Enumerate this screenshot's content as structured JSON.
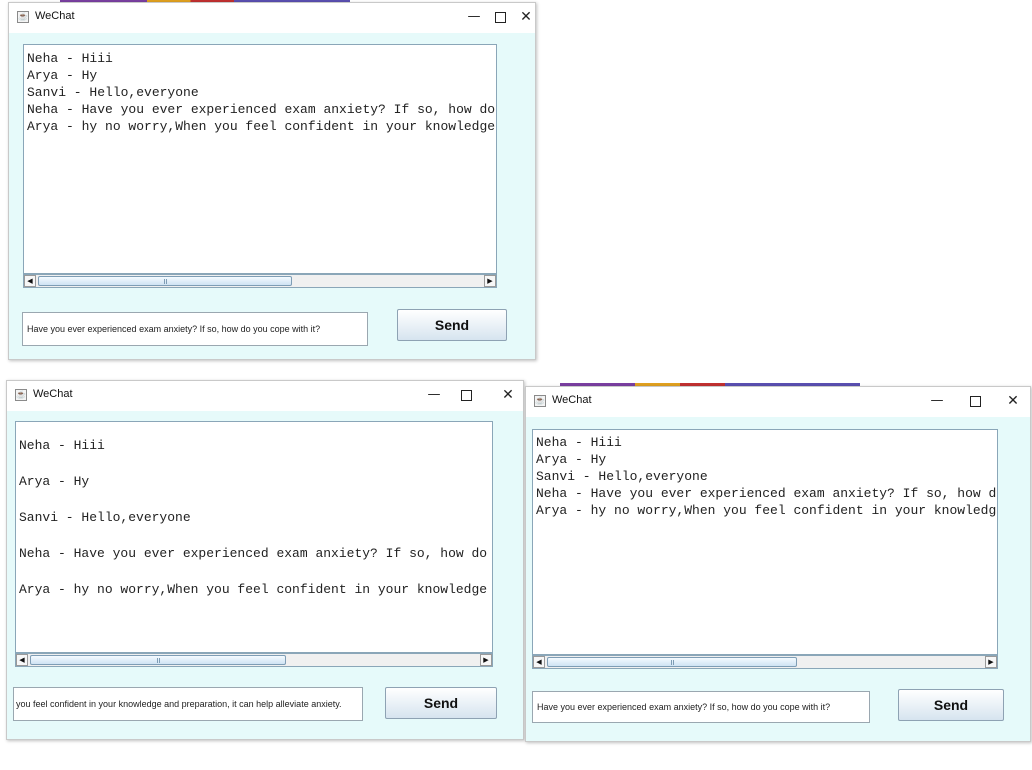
{
  "windows": [
    {
      "title": "WeChat",
      "controls": {
        "minimize": "—",
        "close": "✕"
      },
      "messages": [
        "Neha - Hiii",
        "Arya - Hy",
        "Sanvi - Hello,everyone",
        "Neha - Have you ever experienced exam anxiety? If so, how do",
        "Arya - hy no worry,When you feel confident in your knowledge"
      ],
      "input_value": "Have you ever experienced exam anxiety? If so, how do you cope with it?",
      "send_label": "Send"
    },
    {
      "title": "WeChat",
      "controls": {
        "minimize": "—",
        "close": "✕"
      },
      "messages": [
        "Neha - Hiii",
        "Arya - Hy",
        "Sanvi - Hello,everyone",
        "Neha - Have you ever experienced exam anxiety? If so, how do",
        "Arya - hy no worry,When you feel confident in your knowledge"
      ],
      "input_value": "you feel confident in your knowledge and preparation, it can help alleviate anxiety.",
      "send_label": "Send"
    },
    {
      "title": "WeChat",
      "controls": {
        "minimize": "—",
        "close": "✕"
      },
      "messages": [
        "Neha - Hiii",
        "Arya - Hy",
        "Sanvi - Hello,everyone",
        "Neha - Have you ever experienced exam anxiety? If so, how do",
        "Arya - hy no worry,When you feel confident in your knowledge"
      ],
      "input_value": "Have you ever experienced exam anxiety? If so, how do you cope with it?",
      "send_label": "Send"
    }
  ],
  "icons": {
    "app": "java-cup-icon",
    "minimize": "minimize-icon",
    "maximize": "maximize-icon",
    "close": "close-icon",
    "scroll_left": "scroll-left-arrow-icon",
    "scroll_right": "scroll-right-arrow-icon"
  },
  "colors": {
    "window_bg": "#e6fafa",
    "titlebar_bg": "#ffffff",
    "chat_bg": "#ffffff",
    "button_gradient_bottom": "#d6e4ef"
  }
}
